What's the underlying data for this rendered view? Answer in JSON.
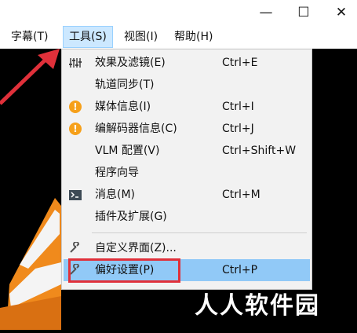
{
  "window": {
    "minimize_glyph": "—",
    "maximize_glyph": "☐",
    "close_glyph": "✕"
  },
  "menubar": {
    "items": [
      {
        "label": "字幕(T)"
      },
      {
        "label": "工具(S)",
        "active": true
      },
      {
        "label": "视图(I)"
      },
      {
        "label": "帮助(H)"
      }
    ]
  },
  "tools_menu": {
    "items": [
      {
        "icon": "equalizer-icon",
        "label": "效果及滤镜(E)",
        "shortcut": "Ctrl+E"
      },
      {
        "icon": "",
        "label": "轨道同步(T)",
        "shortcut": ""
      },
      {
        "icon": "info-icon",
        "label": "媒体信息(I)",
        "shortcut": "Ctrl+I"
      },
      {
        "icon": "info-icon",
        "label": "编解码器信息(C)",
        "shortcut": "Ctrl+J"
      },
      {
        "icon": "",
        "label": "VLM 配置(V)",
        "shortcut": "Ctrl+Shift+W"
      },
      {
        "icon": "",
        "label": "程序向导",
        "shortcut": ""
      },
      {
        "icon": "terminal-icon",
        "label": "消息(M)",
        "shortcut": "Ctrl+M"
      },
      {
        "icon": "",
        "label": "插件及扩展(G)",
        "shortcut": ""
      },
      {
        "icon": "wrench-icon",
        "label": "自定义界面(Z)...",
        "shortcut": ""
      },
      {
        "icon": "wrench-icon",
        "label": "偏好设置(P)",
        "shortcut": "Ctrl+P",
        "highlighted": true
      }
    ]
  },
  "watermark": "人人软件园",
  "colors": {
    "highlight": "#91c9f7",
    "annotation": "#e0303a",
    "warning_icon": "#f6a01a",
    "cone_orange": "#f08a1c"
  }
}
